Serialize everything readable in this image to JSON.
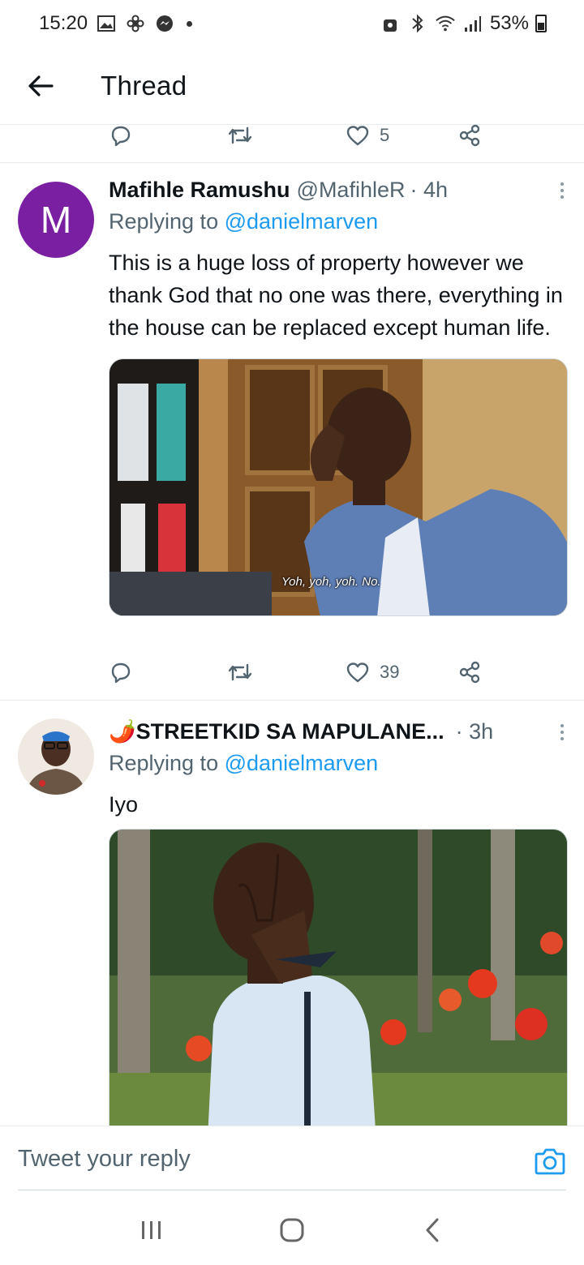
{
  "status_bar": {
    "time": "15:20",
    "battery": "53%"
  },
  "header": {
    "title": "Thread"
  },
  "top_actions": {
    "like_count": "5"
  },
  "tweets": [
    {
      "avatar_letter": "M",
      "author": "Mafihle Ramushu",
      "handle": "@MafihleR",
      "time": "· 4h",
      "replying_prefix": "Replying to",
      "replying_to": "@danielmarven",
      "text": "This is a huge loss of property however we thank God that no one was there, everything in the house can be replaced except human life.",
      "media_caption": "Yoh, yoh, yoh. No.",
      "like_count": "39"
    },
    {
      "author": "🌶️STREETKID SA MAPULANE...",
      "time": "· 3h",
      "replying_prefix": "Replying to",
      "replying_to": "@danielmarven",
      "text": "Iyo"
    }
  ],
  "composer": {
    "placeholder": "Tweet your reply"
  },
  "colors": {
    "accent": "#1d9bf0",
    "secondary_text": "#536471",
    "avatar_bg": "#7b1fa2"
  }
}
